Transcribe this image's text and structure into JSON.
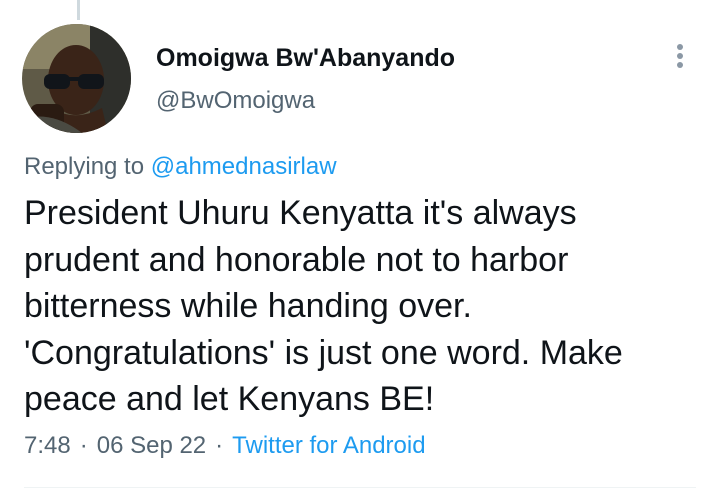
{
  "tweet": {
    "author": {
      "display_name": "Omoigwa Bw'Abanyando",
      "handle": "@BwOmoigwa",
      "avatar_icon": "profile-photo-man-sunglasses"
    },
    "replying": {
      "prefix": "Replying to",
      "mention": "@ahmednasirlaw"
    },
    "text": "President Uhuru Kenyatta it's always\nprudent and honorable not to harbor\nbitterness while handing over.\n'Congratulations' is just one word. Make\npeace and let Kenyans BE!",
    "meta": {
      "time": "7:48",
      "date": "06 Sep 22",
      "separator": "·",
      "source": "Twitter for Android"
    },
    "more_icon": "more-vertical-icon"
  },
  "colors": {
    "primary_text": "#0f1419",
    "secondary_text": "#536471",
    "link": "#1d9bf0",
    "divider": "#eff3f4",
    "thread_line": "#cfd9de"
  }
}
